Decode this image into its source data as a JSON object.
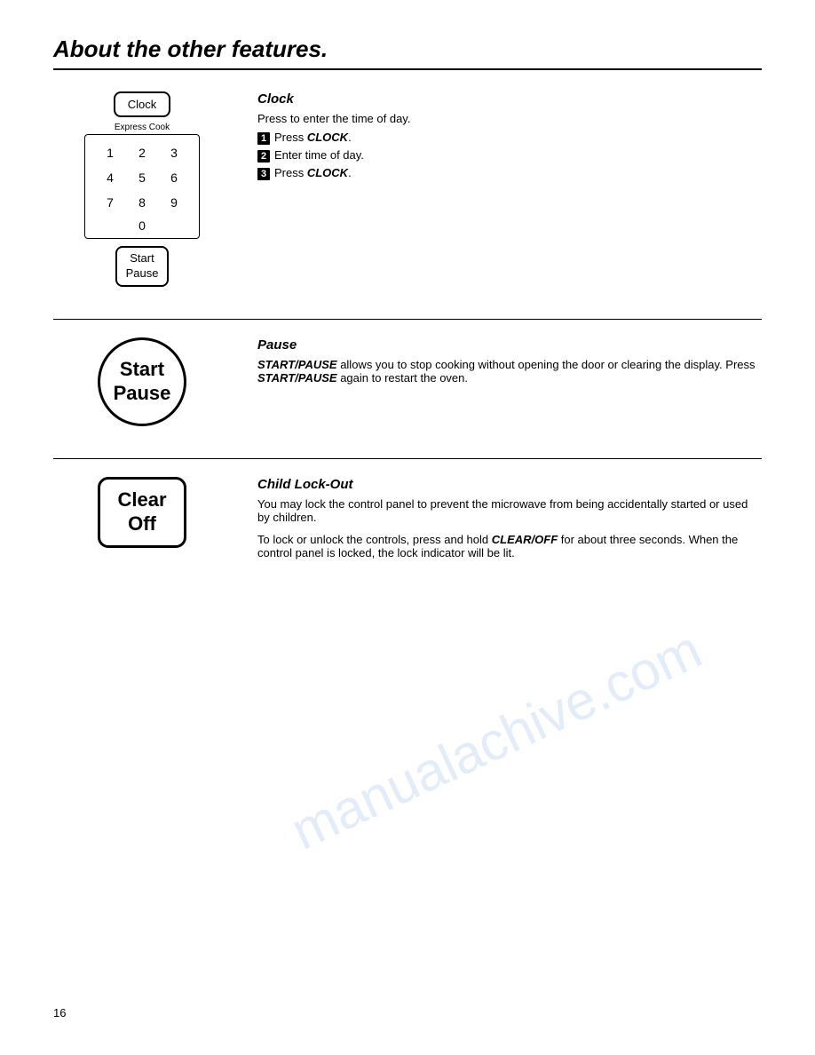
{
  "page": {
    "title": "About the other features.",
    "page_number": "16"
  },
  "watermark": "manualachive.com",
  "sections": [
    {
      "id": "clock",
      "heading": "Clock",
      "button_label": "Clock",
      "intro": "Press to enter the time of day.",
      "keypad_label": "Express Cook",
      "keypad_keys": [
        "1",
        "2",
        "3",
        "4",
        "5",
        "6",
        "7",
        "8",
        "9"
      ],
      "keypad_zero": "0",
      "extra_button": "Start\nPause",
      "steps": [
        {
          "num": "1",
          "text": "Press ",
          "bold_italic": "CLOCK",
          "after": "."
        },
        {
          "num": "2",
          "text": "Enter time of day.",
          "bold_italic": "",
          "after": ""
        },
        {
          "num": "3",
          "text": "Press ",
          "bold_italic": "CLOCK",
          "after": "."
        }
      ]
    },
    {
      "id": "pause",
      "heading": "Pause",
      "button_label": "Start\nPause",
      "description_parts": [
        {
          "text": "",
          "bold_italic": "START/PAUSE",
          "after": " allows you to stop cooking without opening the door or clearing the display. Press "
        },
        {
          "bold_italic": "START/PAUSE",
          "after": " again to restart the oven."
        }
      ]
    },
    {
      "id": "child-lock",
      "heading": "Child Lock-Out",
      "button_label": "Clear\nOff",
      "para1": "You may lock the control panel to prevent the microwave from being accidentally started or used by children.",
      "para2_prefix": "To lock or unlock the controls, press and hold ",
      "para2_bold": "CLEAR/OFF",
      "para2_suffix": " for about three seconds. When the control panel is locked, the lock indicator will be lit."
    }
  ]
}
